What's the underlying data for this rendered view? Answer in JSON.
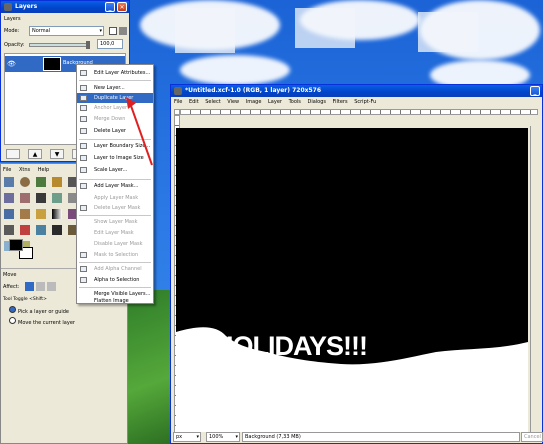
{
  "layers_window": {
    "title": "Layers",
    "panel_label": "Layers",
    "mode_label": "Mode:",
    "mode_value": "Normal",
    "opacity_label": "Opacity:",
    "opacity_value": "100,0",
    "layer_name": "Background"
  },
  "context_menu": {
    "items": [
      {
        "label": "Edit Layer Attributes...",
        "disabled": false
      },
      {
        "label": "New Layer...",
        "disabled": false
      },
      {
        "label": "Duplicate Layer",
        "disabled": false,
        "highlighted": true
      },
      {
        "label": "Anchor Layer",
        "disabled": true
      },
      {
        "label": "Merge Down",
        "disabled": true
      },
      {
        "label": "Delete Layer",
        "disabled": false
      },
      {
        "label": "Layer Boundary Size...",
        "disabled": false
      },
      {
        "label": "Layer to Image Size",
        "disabled": false
      },
      {
        "label": "Scale Layer...",
        "disabled": false
      },
      {
        "label": "Add Layer Mask...",
        "disabled": false
      },
      {
        "label": "Apply Layer Mask",
        "disabled": true
      },
      {
        "label": "Delete Layer Mask",
        "disabled": true
      },
      {
        "label": "Show Layer Mask",
        "disabled": true
      },
      {
        "label": "Edit Layer Mask",
        "disabled": true
      },
      {
        "label": "Disable Layer Mask",
        "disabled": true
      },
      {
        "label": "Mask to Selection",
        "disabled": true
      },
      {
        "label": "Add Alpha Channel",
        "disabled": true
      },
      {
        "label": "Alpha to Selection",
        "disabled": false
      },
      {
        "label": "Merge Visible Layers...",
        "disabled": false
      },
      {
        "label": "Flatten Image",
        "disabled": false
      }
    ]
  },
  "toolbox": {
    "menus": [
      "File",
      "Xtns",
      "Help"
    ],
    "tool_options_title": "Move",
    "affect_label": "Affect:",
    "tool_toggle_label": "Tool Toggle  <Shift>",
    "option_pick": "Pick a layer or guide",
    "option_move": "Move the current layer"
  },
  "image_window": {
    "title": "*Untitled.xcf-1.0 (RGB, 1 layer) 720x576",
    "menus": [
      "File",
      "Edit",
      "Select",
      "View",
      "Image",
      "Layer",
      "Tools",
      "Dialogs",
      "Filters",
      "Script-Fu"
    ],
    "canvas_text": "HOLIDAYS!!!",
    "unit": "px",
    "zoom": "100%",
    "status": "Background (7,33 MB)",
    "cancel": "Cancel"
  },
  "colors": {
    "highlight": "#316ac5",
    "xp_title": "#0a5fe6",
    "annotation_arrow": "#e02020"
  }
}
